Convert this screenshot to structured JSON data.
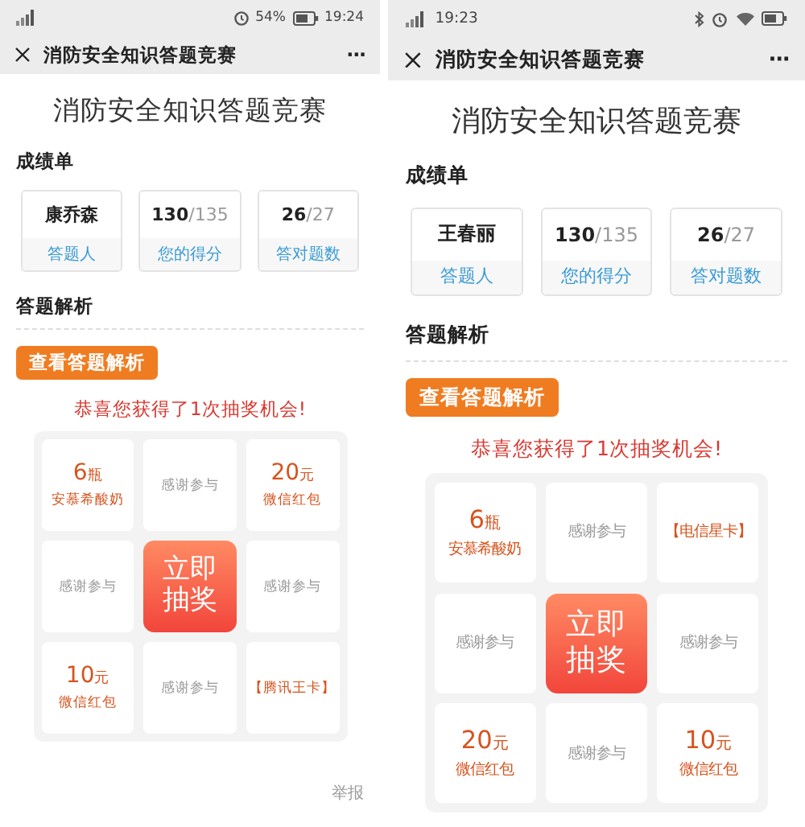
{
  "phones": [
    {
      "status_bar": {
        "kind": "time-right",
        "battery": "54%",
        "time": "19:24"
      },
      "title": "消防安全知识答题竞赛",
      "menu": "···",
      "heading": "消防安全知识答题竞赛",
      "score_section": "成绩单",
      "cards": [
        {
          "value": "康乔森",
          "label": "答题人"
        },
        {
          "value": "130",
          "total": "/135",
          "label": "您的得分"
        },
        {
          "value": "26",
          "total": "/27",
          "label": "答对题数"
        }
      ],
      "analysis_section": "答题解析",
      "analysis_button": "查看答题解析",
      "congrats": "恭喜您获得了1次抽奖机会!",
      "prizes": [
        {
          "kind": "prize",
          "amount": "6",
          "unit": "瓶",
          "name": "安慕希酸奶"
        },
        {
          "kind": "thanks",
          "text": "感谢参与"
        },
        {
          "kind": "prize",
          "amount": "20",
          "unit": "元",
          "name": "微信红包"
        },
        {
          "kind": "thanks",
          "text": "感谢参与"
        },
        {
          "kind": "start",
          "lines": [
            "立即",
            "抽奖"
          ]
        },
        {
          "kind": "thanks",
          "text": "感谢参与"
        },
        {
          "kind": "prize",
          "amount": "10",
          "unit": "元",
          "name": "微信红包"
        },
        {
          "kind": "thanks",
          "text": "感谢参与"
        },
        {
          "kind": "card",
          "text": "【腾讯王卡】"
        }
      ],
      "report": "举报"
    },
    {
      "status_bar": {
        "kind": "time-left",
        "time": "19:23"
      },
      "title": "消防安全知识答题竞赛",
      "menu": "···",
      "heading": "消防安全知识答题竞赛",
      "score_section": "成绩单",
      "cards": [
        {
          "value": "王春丽",
          "label": "答题人"
        },
        {
          "value": "130",
          "total": "/135",
          "label": "您的得分"
        },
        {
          "value": "26",
          "total": "/27",
          "label": "答对题数"
        }
      ],
      "analysis_section": "答题解析",
      "analysis_button": "查看答题解析",
      "congrats": "恭喜您获得了1次抽奖机会!",
      "prizes": [
        {
          "kind": "prize",
          "amount": "6",
          "unit": "瓶",
          "name": "安慕希酸奶"
        },
        {
          "kind": "thanks",
          "text": "感谢参与"
        },
        {
          "kind": "card",
          "text": "【电信星卡】"
        },
        {
          "kind": "thanks",
          "text": "感谢参与"
        },
        {
          "kind": "start",
          "lines": [
            "立即",
            "抽奖"
          ]
        },
        {
          "kind": "thanks",
          "text": "感谢参与"
        },
        {
          "kind": "prize",
          "amount": "20",
          "unit": "元",
          "name": "微信红包"
        },
        {
          "kind": "thanks",
          "text": "感谢参与"
        },
        {
          "kind": "prize",
          "amount": "10",
          "unit": "元",
          "name": "微信红包"
        }
      ]
    }
  ]
}
